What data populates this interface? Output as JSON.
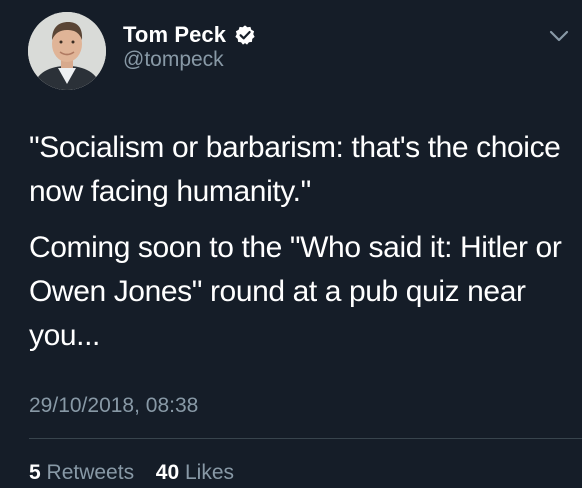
{
  "theme": {
    "background": "#151d28",
    "primary_text": "#ffffff",
    "secondary_text": "#8899a6",
    "verified_badge": "#ffffff",
    "divider": "#38444d"
  },
  "author": {
    "display_name": "Tom Peck",
    "handle": "@tompeck",
    "verified": true,
    "avatar_icon": "profile-photo",
    "verified_icon": "verified-badge-icon"
  },
  "menu": {
    "icon": "chevron-down-icon"
  },
  "tweet": {
    "paragraphs": [
      "\"Socialism or barbarism: that's the choice now facing humanity.\"",
      "Coming soon to the \"Who said it: Hitler or Owen Jones\" round at a pub quiz near you..."
    ],
    "timestamp": "29/10/2018, 08:38"
  },
  "stats": {
    "retweets_count": "5",
    "retweets_label": "Retweets",
    "likes_count": "40",
    "likes_label": "Likes"
  }
}
